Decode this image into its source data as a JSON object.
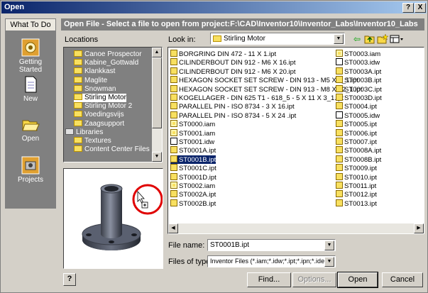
{
  "window": {
    "title": "Open",
    "help_btn": "?",
    "close_btn": "X"
  },
  "nav": {
    "header": "What To Do",
    "items": [
      {
        "label_1": "Getting",
        "label_2": "Started",
        "icon": "getting-started-icon"
      },
      {
        "label_1": "New",
        "label_2": "",
        "icon": "new-document-icon"
      },
      {
        "label_1": "Open",
        "label_2": "",
        "icon": "open-folder-icon"
      },
      {
        "label_1": "Projects",
        "label_2": "",
        "icon": "projects-icon"
      }
    ]
  },
  "header": {
    "text": "Open File - Select a file to open from project:F:\\CAD\\Inventor10\\Inventor_Labs\\Inventor10_Labs"
  },
  "locations": {
    "label": "Locations",
    "items": [
      {
        "text": "Canoe Prospector",
        "selected": false,
        "indent": 1
      },
      {
        "text": "Kabine_Gottwald",
        "selected": false,
        "indent": 1
      },
      {
        "text": "Klankkast",
        "selected": false,
        "indent": 1
      },
      {
        "text": "Maglite",
        "selected": false,
        "indent": 1
      },
      {
        "text": "Snowman",
        "selected": false,
        "indent": 1
      },
      {
        "text": "Stirling Motor",
        "selected": true,
        "indent": 1
      },
      {
        "text": "Stirling Motor 2",
        "selected": false,
        "indent": 1
      },
      {
        "text": "Voedingsvijs",
        "selected": false,
        "indent": 1
      },
      {
        "text": "Zaagsupport",
        "selected": false,
        "indent": 1
      },
      {
        "text": "Libraries",
        "selected": false,
        "indent": 0
      },
      {
        "text": "Textures",
        "selected": false,
        "indent": 1
      },
      {
        "text": "Content Center Files",
        "selected": false,
        "indent": 1
      }
    ]
  },
  "lookin": {
    "label": "Look in:",
    "value": "Stirling Motor"
  },
  "files": {
    "col1": [
      {
        "name": "BORGRING DIN 472 - 11 X 1.ipt",
        "type": "ipt"
      },
      {
        "name": "CILINDERBOUT DIN 912 - M6 X 16.ipt",
        "type": "ipt"
      },
      {
        "name": "CILINDERBOUT DIN 912 - M6 X 20.ipt",
        "type": "ipt"
      },
      {
        "name": "HEXAGON SOCKET SET SCREW - DIN 913 - M5 X 8_1.ipt",
        "type": "ipt"
      },
      {
        "name": "HEXAGON SOCKET SET SCREW - DIN 913 - M8 X 12_1.ipt",
        "type": "ipt"
      },
      {
        "name": "KOGELLAGER - DIN 625 T1 - 618_5 - 5 X 11 X 3_1.ipt",
        "type": "ipt"
      },
      {
        "name": "PARALLEL PIN - ISO 8734 - 3 X 16.ipt",
        "type": "ipt"
      },
      {
        "name": "PARALLEL PIN - ISO 8734 - 5 X 24 .ipt",
        "type": "ipt"
      },
      {
        "name": "ST0000.iam",
        "type": "iam"
      },
      {
        "name": "ST0001.iam",
        "type": "iam"
      },
      {
        "name": "ST0001.idw",
        "type": "idw"
      },
      {
        "name": "ST0001A.ipt",
        "type": "ipt"
      },
      {
        "name": "ST0001B.ipt",
        "type": "ipt",
        "selected": true
      },
      {
        "name": "ST0001C.ipt",
        "type": "ipt"
      },
      {
        "name": "ST0001D.ipt",
        "type": "ipt"
      },
      {
        "name": "ST0002.iam",
        "type": "iam"
      },
      {
        "name": "ST0002A.ipt",
        "type": "ipt"
      },
      {
        "name": "ST0002B.ipt",
        "type": "ipt"
      }
    ],
    "col2": [
      {
        "name": "ST0003.iam",
        "type": "iam"
      },
      {
        "name": "ST0003.idw",
        "type": "idw"
      },
      {
        "name": "ST0003A.ipt",
        "type": "ipt"
      },
      {
        "name": "ST0003B.ipt",
        "type": "ipt"
      },
      {
        "name": "ST0003C.ipt",
        "type": "ipt"
      },
      {
        "name": "ST0003D.ipt",
        "type": "ipt"
      },
      {
        "name": "ST0004.ipt",
        "type": "ipt"
      },
      {
        "name": "ST0005.idw",
        "type": "idw"
      },
      {
        "name": "ST0005.ipt",
        "type": "ipt"
      },
      {
        "name": "ST0006.ipt",
        "type": "ipt"
      },
      {
        "name": "ST0007.ipt",
        "type": "ipt"
      },
      {
        "name": "ST0008A.ipt",
        "type": "ipt"
      },
      {
        "name": "ST0008B.ipt",
        "type": "ipt"
      },
      {
        "name": "ST0009.ipt",
        "type": "ipt"
      },
      {
        "name": "ST0010.ipt",
        "type": "ipt"
      },
      {
        "name": "ST0011.ipt",
        "type": "ipt"
      },
      {
        "name": "ST0012.ipt",
        "type": "ipt"
      },
      {
        "name": "ST0013.ipt",
        "type": "ipt"
      }
    ]
  },
  "filename": {
    "label": "File name:",
    "value": "ST0001B.ipt"
  },
  "filetype": {
    "label": "Files of type:",
    "value": "Inventor Files (*.iam;*.idw;*.ipt;*.ipn;*.ide)"
  },
  "buttons": {
    "find": "Find...",
    "options": "Options...",
    "open": "Open",
    "cancel": "Cancel",
    "help": "?"
  },
  "colors": {
    "title_start": "#0a246a",
    "title_end": "#a6caf0",
    "header_bg": "#808080",
    "selection": "#0a246a",
    "annotation_circle": "#e00000"
  }
}
